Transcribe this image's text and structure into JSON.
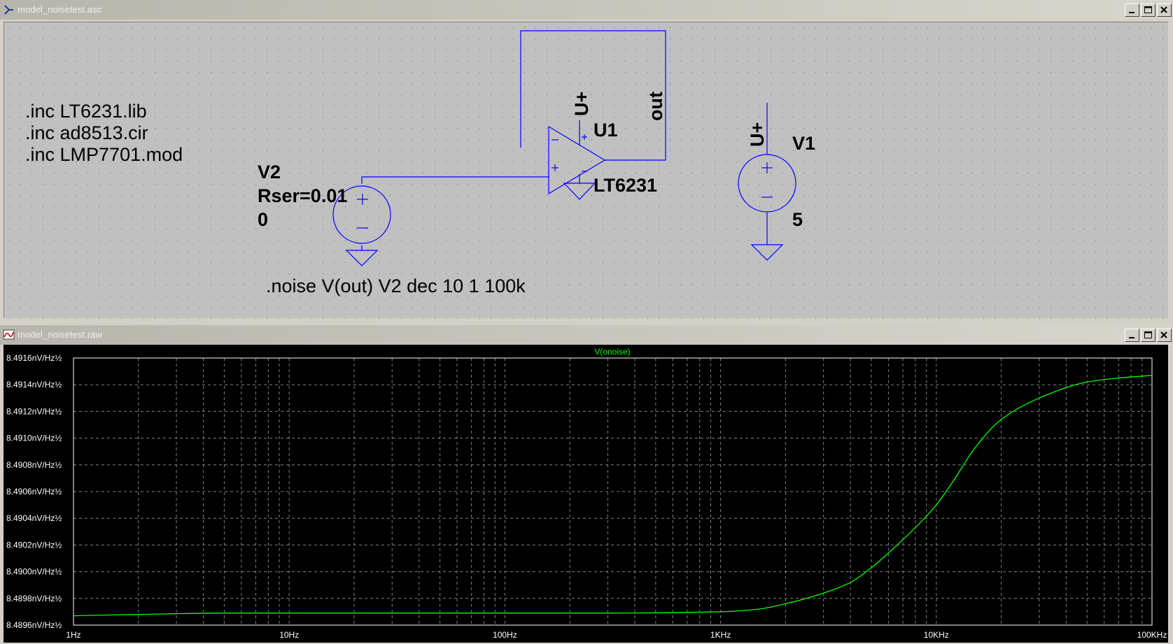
{
  "schematic_window": {
    "title": "model_noisetest.asc",
    "directives": [
      ".inc LT6231.lib",
      ".inc ad8513.cir",
      ".inc LMP7701.mod"
    ],
    "analysis": ".noise V(out) V2 dec 10 1 100k",
    "components": {
      "opamp": {
        "ref": "U1",
        "model": "LT6231",
        "supply_label": "U+"
      },
      "source_v2": {
        "ref": "V2",
        "line2": "Rser=0.01",
        "value": "0"
      },
      "source_v1": {
        "ref": "V1",
        "value": "5",
        "supply_label": "U+"
      },
      "net_label_out": "out"
    },
    "colors": {
      "background": "#c0c0c0",
      "wire": "#0000ff",
      "text": "#000000"
    }
  },
  "plot_window": {
    "title": "model_noisetest.raw",
    "colors": {
      "background": "#000000",
      "grid": "#808080",
      "trace": "#00ff00",
      "text": "#ffffff"
    }
  },
  "chart_data": {
    "type": "line",
    "title": "V(onoise)",
    "x_scale": "log",
    "x_ticks": [
      "1Hz",
      "10Hz",
      "100Hz",
      "1KHz",
      "10KHz",
      "100KHz"
    ],
    "y_ticks": [
      "8.4916nV/Hz½",
      "8.4914nV/Hz½",
      "8.4912nV/Hz½",
      "8.4910nV/Hz½",
      "8.4908nV/Hz½",
      "8.4906nV/Hz½",
      "8.4904nV/Hz½",
      "8.4902nV/Hz½",
      "8.4900nV/Hz½",
      "8.4898nV/Hz½",
      "8.4896nV/Hz½"
    ],
    "xlim": [
      1,
      100000
    ],
    "ylim": [
      8.4896,
      8.4916
    ],
    "y_unit": "nV/Hz½",
    "grid": true,
    "series": [
      {
        "name": "V(onoise)",
        "x": [
          1,
          2,
          5,
          10,
          100,
          300,
          1000,
          1500,
          2000,
          3000,
          4000,
          5000,
          6000,
          7000,
          8000,
          10000,
          12000,
          15000,
          20000,
          30000,
          50000,
          70000,
          100000
        ],
        "y": [
          8.48967,
          8.48968,
          8.48969,
          8.48969,
          8.48969,
          8.48969,
          8.4897,
          8.48972,
          8.48976,
          8.48984,
          8.48992,
          8.49003,
          8.49014,
          8.49024,
          8.49033,
          8.4905,
          8.49068,
          8.49092,
          8.49114,
          8.4913,
          8.49142,
          8.49145,
          8.49147
        ]
      }
    ]
  }
}
